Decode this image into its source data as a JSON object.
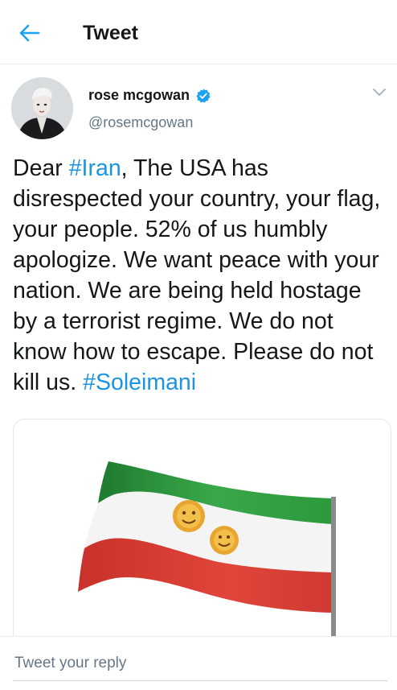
{
  "header": {
    "title": "Tweet",
    "back_icon": "arrow-left-icon",
    "accent": "#1da1f2"
  },
  "tweet": {
    "author": {
      "display_name": "rose mcgowan",
      "handle": "@rosemcgowan",
      "verified_icon": "verified-badge-icon"
    },
    "menu_icon": "chevron-down-icon",
    "text": {
      "p1": "Dear ",
      "tag1": "#Iran",
      "p2": ", The USA has disrespected your country, your flag, your people. 52% of us humbly apologize. We want peace with your nation. We are being held hostage by a terrorist regime. We do not know how to escape. Please do not kill us. ",
      "tag2": "#Soleimani"
    },
    "media": {
      "description_icon": "waving-flag-icon"
    }
  },
  "reply": {
    "placeholder": "Tweet your reply"
  },
  "colors": {
    "link": "#1b95e0",
    "secondary_text": "#657786",
    "flag_green": "#2f9a3f",
    "flag_red": "#d83a32"
  }
}
